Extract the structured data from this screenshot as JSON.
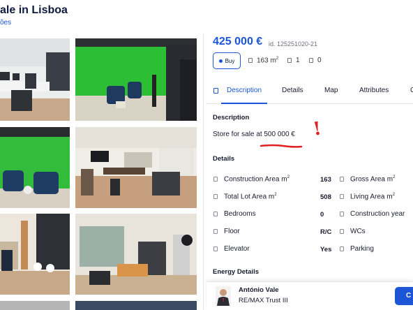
{
  "header": {
    "title": "ale in Lisboa",
    "sub_link": "ões"
  },
  "gallery": {
    "photos": [
      {
        "icon": "office-desk-photo"
      },
      {
        "icon": "green-screen-studio-photo"
      },
      {
        "icon": "green-screen-sofa-photo"
      },
      {
        "icon": "workspace-tv-photo"
      },
      {
        "icon": "kitchen-area-photo"
      },
      {
        "icon": "equipment-room-photo"
      }
    ]
  },
  "listing": {
    "price": "425 000 €",
    "id_label": "id. 125251020-21",
    "buy_label": "Buy",
    "area": "163 m",
    "area_sup": "2",
    "rooms": "1",
    "baths": "0"
  },
  "tabs": [
    {
      "label": "Description",
      "active": true
    },
    {
      "label": "Details",
      "active": false
    },
    {
      "label": "Map",
      "active": false
    },
    {
      "label": "Attributes",
      "active": false
    },
    {
      "label": "C",
      "active": false
    }
  ],
  "description": {
    "title": "Description",
    "text": "Store for sale at 500 000 €"
  },
  "annotation": {
    "mark": "!",
    "color": "#e02020"
  },
  "details": {
    "title": "Details",
    "left": [
      {
        "label": "Construction Area m",
        "sup": "2",
        "value": "163"
      },
      {
        "label": "Total Lot Area m",
        "sup": "2",
        "value": "508"
      },
      {
        "label": "Bedrooms",
        "sup": "",
        "value": "0"
      },
      {
        "label": "Floor",
        "sup": "",
        "value": "R/C"
      },
      {
        "label": "Elevator",
        "sup": "",
        "value": "Yes"
      }
    ],
    "right": [
      {
        "label": "Gross Area m",
        "sup": "2"
      },
      {
        "label": "Living Area m",
        "sup": "2"
      },
      {
        "label": "Construction year",
        "sup": ""
      },
      {
        "label": "WCs",
        "sup": ""
      },
      {
        "label": "Parking",
        "sup": ""
      }
    ]
  },
  "energy": {
    "title": "Energy Details"
  },
  "agent": {
    "name": "António Vale",
    "company": "RE/MAX Trust III",
    "contact_label": "C"
  },
  "colors": {
    "accent": "#1c56d6",
    "title": "#0d1b3e"
  }
}
